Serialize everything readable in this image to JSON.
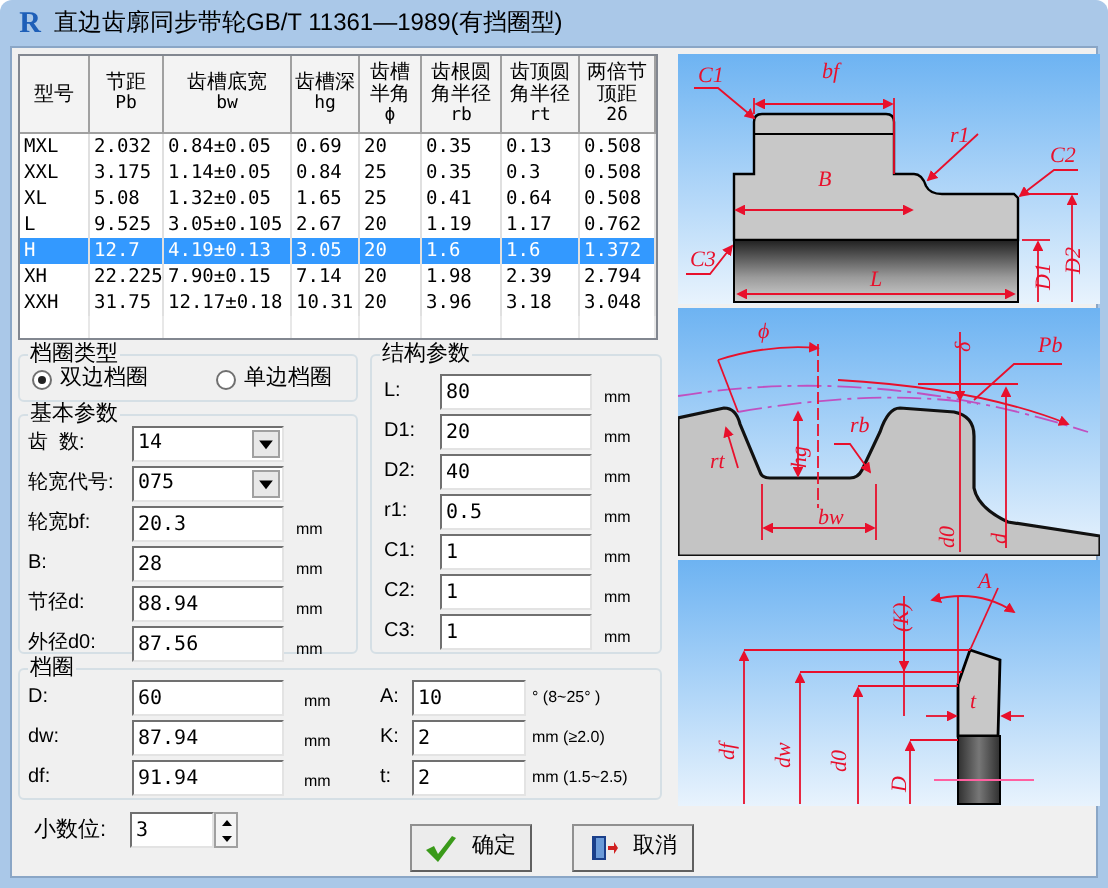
{
  "window": {
    "title": "直边齿廓同步带轮GB/T 11361—1989(有挡圈型)",
    "logo_text": "R"
  },
  "table": {
    "columns": [
      {
        "label": "型号"
      },
      {
        "label": "节距",
        "symbol": "Pb"
      },
      {
        "label": "齿槽底宽",
        "symbol": "bw"
      },
      {
        "label": "齿槽深",
        "symbol": "hg"
      },
      {
        "label": "齿槽半角",
        "symbol": "ϕ"
      },
      {
        "label": "齿根圆角半径",
        "symbol": "rb"
      },
      {
        "label": "齿顶圆角半径",
        "symbol": "rt"
      },
      {
        "label": "两倍节顶距",
        "symbol": "2δ"
      }
    ],
    "rows": [
      {
        "cells": [
          "MXL",
          "2.032",
          "0.84±0.05",
          "0.69",
          "20",
          "0.35",
          "0.13",
          "0.508"
        ],
        "selected": false
      },
      {
        "cells": [
          "XXL",
          "3.175",
          "1.14±0.05",
          "0.84",
          "25",
          "0.35",
          "0.3",
          "0.508"
        ],
        "selected": false
      },
      {
        "cells": [
          "XL",
          "5.08",
          "1.32±0.05",
          "1.65",
          "25",
          "0.41",
          "0.64",
          "0.508"
        ],
        "selected": false
      },
      {
        "cells": [
          "L",
          "9.525",
          "3.05±0.105",
          "2.67",
          "20",
          "1.19",
          "1.17",
          "0.762"
        ],
        "selected": false
      },
      {
        "cells": [
          "H",
          "12.7",
          "4.19±0.13",
          "3.05",
          "20",
          "1.6",
          "1.6",
          "1.372"
        ],
        "selected": true
      },
      {
        "cells": [
          "XH",
          "22.225",
          "7.90±0.15",
          "7.14",
          "20",
          "1.98",
          "2.39",
          "2.794"
        ],
        "selected": false
      },
      {
        "cells": [
          "XXH",
          "31.75",
          "12.17±0.18",
          "10.31",
          "20",
          "3.96",
          "3.18",
          "3.048"
        ],
        "selected": false
      }
    ]
  },
  "ring_type": {
    "title": "档圈类型",
    "options": [
      {
        "label": "双边档圈",
        "selected": true
      },
      {
        "label": "单边档圈",
        "selected": false
      }
    ]
  },
  "basic_params": {
    "title": "基本参数",
    "fields": [
      {
        "kind": "dropdown",
        "label": "齿  数:",
        "value": "14"
      },
      {
        "kind": "dropdown",
        "label": "轮宽代号:",
        "value": "075"
      },
      {
        "kind": "input",
        "label": "轮宽bf:",
        "value": "20.3",
        "unit": "mm"
      },
      {
        "kind": "input",
        "label": "B:",
        "value": "28",
        "unit": "mm"
      },
      {
        "kind": "input",
        "label": "节径d:",
        "value": "88.94",
        "unit": "mm"
      },
      {
        "kind": "input",
        "label": "外径d0:",
        "value": "87.56",
        "unit": "mm"
      }
    ]
  },
  "structure_params": {
    "title": "结构参数",
    "fields": [
      {
        "label": "L:",
        "value": "80",
        "unit": "mm"
      },
      {
        "label": "D1:",
        "value": "20",
        "unit": "mm"
      },
      {
        "label": "D2:",
        "value": "40",
        "unit": "mm"
      },
      {
        "label": "r1:",
        "value": "0.5",
        "unit": "mm"
      },
      {
        "label": "C1:",
        "value": "1",
        "unit": "mm"
      },
      {
        "label": "C2:",
        "value": "1",
        "unit": "mm"
      },
      {
        "label": "C3:",
        "value": "1",
        "unit": "mm"
      }
    ]
  },
  "ring": {
    "title": "档圈",
    "left_fields": [
      {
        "label": "D:",
        "value": "60",
        "unit": "mm"
      },
      {
        "label": "dw:",
        "value": "87.94",
        "unit": "mm"
      },
      {
        "label": "df:",
        "value": "91.94",
        "unit": "mm"
      }
    ],
    "right_fields": [
      {
        "label": "A:",
        "value": "10",
        "unit": "° (8~25° )"
      },
      {
        "label": "K:",
        "value": "2",
        "unit": "mm (≥2.0)"
      },
      {
        "label": "t:",
        "value": "2",
        "unit": "mm (1.5~2.5)"
      }
    ]
  },
  "decimals": {
    "label": "小数位:",
    "value": "3"
  },
  "buttons": [
    {
      "kind": "ok",
      "label": "确定"
    },
    {
      "kind": "cancel",
      "label": "取消"
    }
  ],
  "diagrams": [
    {
      "labels": [
        "C1",
        "bf",
        "r1",
        "C2",
        "B",
        "C3",
        "L",
        "D1",
        "D2"
      ]
    },
    {
      "labels": [
        "ϕ",
        "δ",
        "Pb",
        "hg",
        "rt",
        "rb",
        "bw",
        "d0",
        "d"
      ]
    },
    {
      "labels": [
        "A",
        "(K)",
        "t",
        "df",
        "dw",
        "d0",
        "D"
      ]
    }
  ]
}
